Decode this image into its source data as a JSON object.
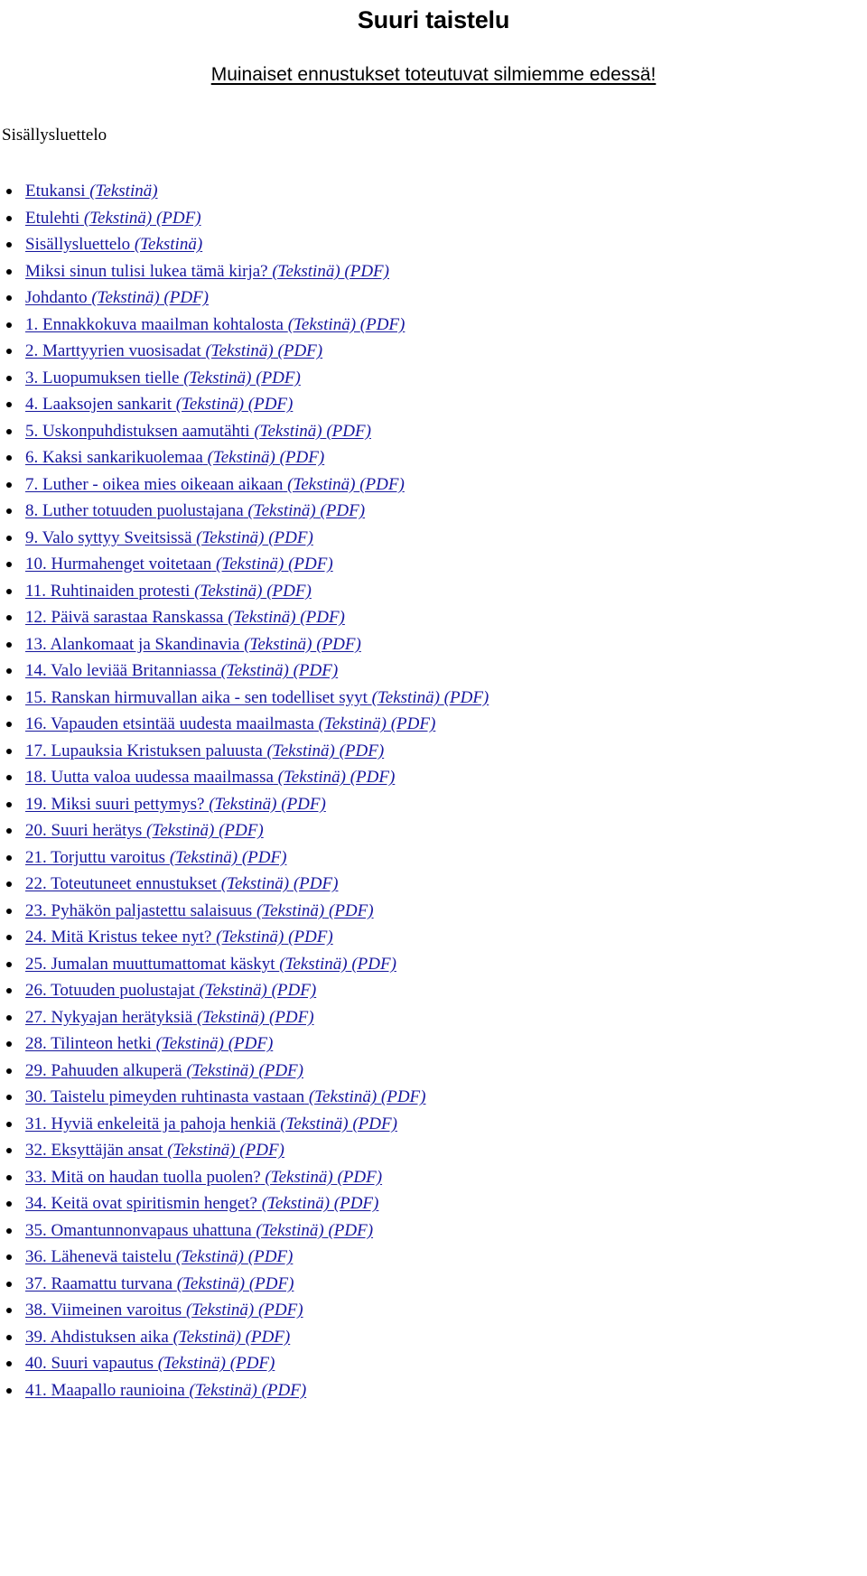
{
  "document": {
    "title": "Suuri taistelu",
    "subtitle": "Muinaiset ennustukset toteutuvat silmiemme edessä!",
    "toc_heading": "Sisällysluettelo",
    "link_color": "#17179e",
    "text_color": "#000000",
    "background_color": "#ffffff"
  },
  "format_labels": {
    "text": "(Tekstinä)",
    "pdf": "(PDF)"
  },
  "toc": {
    "items": [
      {
        "label": "Etukansi",
        "text": "(Tekstinä)",
        "pdf": ""
      },
      {
        "label": "Etulehti",
        "text": "(Tekstinä)",
        "pdf": "(PDF)"
      },
      {
        "label": "Sisällysluettelo",
        "text": "(Tekstinä)",
        "pdf": ""
      },
      {
        "label": "Miksi sinun tulisi lukea tämä kirja?",
        "text": "(Tekstinä)",
        "pdf": "(PDF)"
      },
      {
        "label": "Johdanto",
        "text": "(Tekstinä)",
        "pdf": "(PDF)"
      },
      {
        "label": "1. Ennakkokuva maailman kohtalosta",
        "text": "(Tekstinä)",
        "pdf": "(PDF)"
      },
      {
        "label": "2. Marttyyrien vuosisadat",
        "text": "(Tekstinä)",
        "pdf": "(PDF)"
      },
      {
        "label": "3. Luopumuksen tielle",
        "text": "(Tekstinä)",
        "pdf": "(PDF)"
      },
      {
        "label": "4. Laaksojen sankarit",
        "text": "(Tekstinä)",
        "pdf": "(PDF)"
      },
      {
        "label": "5. Uskonpuhdistuksen aamutähti",
        "text": "(Tekstinä)",
        "pdf": "(PDF)"
      },
      {
        "label": "6. Kaksi sankarikuolemaa",
        "text": "(Tekstinä)",
        "pdf": "(PDF)"
      },
      {
        "label": "7. Luther - oikea mies oikeaan aikaan",
        "text": "(Tekstinä)",
        "pdf": "(PDF)"
      },
      {
        "label": "8. Luther totuuden puolustajana",
        "text": "(Tekstinä)",
        "pdf": "(PDF)"
      },
      {
        "label": "9. Valo syttyy Sveitsissä",
        "text": "(Tekstinä)",
        "pdf": "(PDF)"
      },
      {
        "label": "10. Hurmahenget voitetaan",
        "text": "(Tekstinä)",
        "pdf": "(PDF)"
      },
      {
        "label": "11. Ruhtinaiden protesti",
        "text": "(Tekstinä)",
        "pdf": "(PDF)"
      },
      {
        "label": "12. Päivä sarastaa Ranskassa",
        "text": "(Tekstinä)",
        "pdf": "(PDF)"
      },
      {
        "label": "13. Alankomaat ja Skandinavia",
        "text": "(Tekstinä)",
        "pdf": "(PDF)"
      },
      {
        "label": "14. Valo leviää Britanniassa",
        "text": "(Tekstinä)",
        "pdf": "(PDF)"
      },
      {
        "label": "15. Ranskan hirmuvallan aika - sen todelliset syyt",
        "text": "(Tekstinä)",
        "pdf": "(PDF)"
      },
      {
        "label": "16. Vapauden etsintää uudesta maailmasta",
        "text": "(Tekstinä)",
        "pdf": "(PDF)"
      },
      {
        "label": "17. Lupauksia Kristuksen paluusta",
        "text": "(Tekstinä)",
        "pdf": "(PDF)"
      },
      {
        "label": "18. Uutta valoa uudessa maailmassa",
        "text": "(Tekstinä)",
        "pdf": "(PDF)"
      },
      {
        "label": "19. Miksi suuri pettymys?",
        "text": "(Tekstinä)",
        "pdf": "(PDF)"
      },
      {
        "label": "20. Suuri herätys",
        "text": "(Tekstinä)",
        "pdf": "(PDF)"
      },
      {
        "label": "21. Torjuttu varoitus",
        "text": "(Tekstinä)",
        "pdf": "(PDF)"
      },
      {
        "label": "22. Toteutuneet ennustukset",
        "text": "(Tekstinä)",
        "pdf": "(PDF)"
      },
      {
        "label": "23. Pyhäkön paljastettu salaisuus",
        "text": "(Tekstinä)",
        "pdf": "(PDF)"
      },
      {
        "label": "24. Mitä Kristus tekee nyt?",
        "text": "(Tekstinä)",
        "pdf": "(PDF)"
      },
      {
        "label": "25. Jumalan muuttumattomat käskyt",
        "text": "(Tekstinä)",
        "pdf": "(PDF)"
      },
      {
        "label": "26. Totuuden puolustajat",
        "text": "(Tekstinä)",
        "pdf": "(PDF)"
      },
      {
        "label": "27. Nykyajan herätyksiä",
        "text": "(Tekstinä)",
        "pdf": "(PDF)"
      },
      {
        "label": "28. Tilinteon hetki",
        "text": "(Tekstinä)",
        "pdf": "(PDF)"
      },
      {
        "label": "29. Pahuuden alkuperä",
        "text": "(Tekstinä)",
        "pdf": "(PDF)"
      },
      {
        "label": "30. Taistelu pimeyden ruhtinasta vastaan",
        "text": "(Tekstinä)",
        "pdf": "(PDF)"
      },
      {
        "label": "31. Hyviä enkeleitä ja pahoja henkiä",
        "text": "(Tekstinä)",
        "pdf": "(PDF)"
      },
      {
        "label": "32. Eksyttäjän ansat",
        "text": "(Tekstinä)",
        "pdf": "(PDF)"
      },
      {
        "label": "33. Mitä on haudan tuolla puolen?",
        "text": "(Tekstinä)",
        "pdf": "(PDF)"
      },
      {
        "label": "34. Keitä ovat spiritismin henget?",
        "text": "(Tekstinä)",
        "pdf": "(PDF)"
      },
      {
        "label": "35. Omantunnonvapaus uhattuna",
        "text": "(Tekstinä)",
        "pdf": "(PDF)"
      },
      {
        "label": "36. Lähenevä taistelu",
        "text": "(Tekstinä)",
        "pdf": "(PDF)"
      },
      {
        "label": "37. Raamattu turvana",
        "text": "(Tekstinä)",
        "pdf": "(PDF)"
      },
      {
        "label": "38. Viimeinen varoitus",
        "text": "(Tekstinä)",
        "pdf": "(PDF)"
      },
      {
        "label": "39. Ahdistuksen aika",
        "text": "(Tekstinä)",
        "pdf": "(PDF)"
      },
      {
        "label": "40. Suuri vapautus",
        "text": "(Tekstinä)",
        "pdf": "(PDF)"
      },
      {
        "label": "41. Maapallo raunioina",
        "text": "(Tekstinä)",
        "pdf": "(PDF)"
      }
    ]
  }
}
